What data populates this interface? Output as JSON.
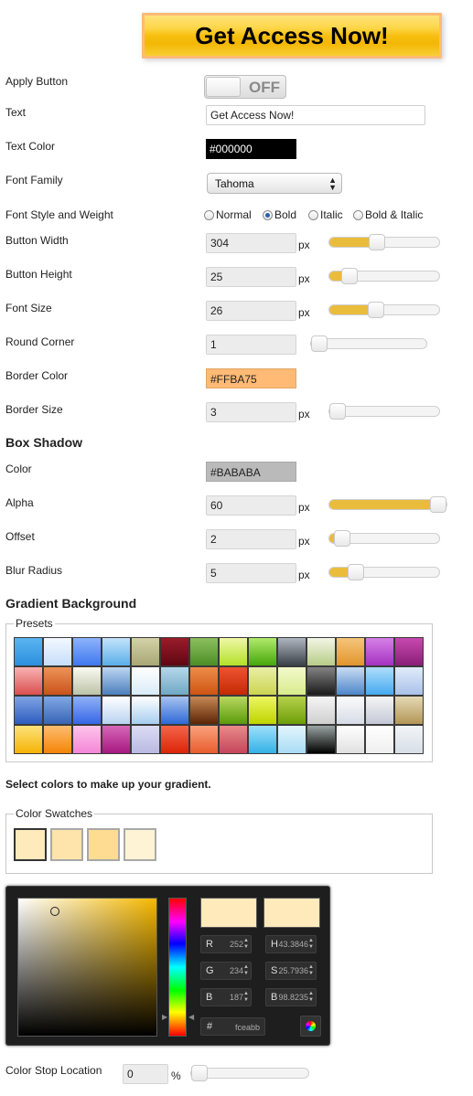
{
  "preview": {
    "text": "Get Access Now!"
  },
  "settings": {
    "apply": {
      "label": "Apply Button",
      "state": "OFF"
    },
    "text": {
      "label": "Text",
      "value": "Get Access Now!"
    },
    "text_color": {
      "label": "Text Color",
      "value": "#000000"
    },
    "font_family": {
      "label": "Font Family",
      "value": "Tahoma"
    },
    "font_style": {
      "label": "Font Style and Weight",
      "options": [
        "Normal",
        "Bold",
        "Italic",
        "Bold & Italic"
      ],
      "selected": "Bold"
    },
    "button_width": {
      "label": "Button Width",
      "value": "304",
      "unit": "px",
      "slider_fraction": 0.42
    },
    "button_height": {
      "label": "Button Height",
      "value": "25",
      "unit": "px",
      "slider_fraction": 0.13
    },
    "font_size": {
      "label": "Font Size",
      "value": "26",
      "unit": "px",
      "slider_fraction": 0.41
    },
    "round_corner": {
      "label": "Round Corner",
      "value": "1",
      "slider_fraction": 0.0
    },
    "border_color": {
      "label": "Border Color",
      "value": "#FFBA75"
    },
    "border_size": {
      "label": "Border Size",
      "value": "3",
      "unit": "px",
      "slider_fraction": 0.0
    }
  },
  "box_shadow": {
    "title": "Box Shadow",
    "color": {
      "label": "Color",
      "value": "#BABABA"
    },
    "alpha": {
      "label": "Alpha",
      "value": "60",
      "unit": "px",
      "slider_fraction": 1.0
    },
    "offset": {
      "label": "Offset",
      "value": "2",
      "unit": "px",
      "slider_fraction": 0.05
    },
    "blur": {
      "label": "Blur Radius",
      "value": "5",
      "unit": "px",
      "slider_fraction": 0.2
    }
  },
  "gradient": {
    "title": "Gradient Background",
    "presets_legend": "Presets",
    "instruction": "Select colors to make up your gradient.",
    "swatches_legend": "Color Swatches",
    "swatches": [
      "#feeabb",
      "#fee4ab",
      "#fedd92",
      "#fef3d4"
    ],
    "presets": [
      [
        "#5ab4ef",
        "#2c8fdf"
      ],
      [
        "#f2f8fe",
        "#c6defa"
      ],
      [
        "#8cb4fb",
        "#3f78ef"
      ],
      [
        "#c4e4fb",
        "#5aaee9"
      ],
      [
        "#d3d2a8",
        "#a9a775"
      ],
      [
        "#9a1c2a",
        "#5f0712"
      ],
      [
        "#8cc05f",
        "#4d8e26"
      ],
      [
        "#eff8a6",
        "#b4e02a"
      ],
      [
        "#b0ea6a",
        "#47a70a"
      ],
      [
        "#b0b6bf",
        "#3b4148"
      ],
      [
        "#f2f6e5",
        "#b8cc88"
      ],
      [
        "#f5c57a",
        "#e2952e"
      ],
      [
        "#d581e6",
        "#a632c1"
      ],
      [
        "#c749b0",
        "#8a1f77"
      ],
      [
        "#f7b2b2",
        "#db4f4f"
      ],
      [
        "#ee9358",
        "#c9521a"
      ],
      [
        "#fafaf2",
        "#bcc3a7"
      ],
      [
        "#bcd6f3",
        "#4c7fbd"
      ],
      [
        "#ffffff",
        "#d9ebf7"
      ],
      [
        "#b6d8ea",
        "#6fa7c4"
      ],
      [
        "#ec8d4b",
        "#cf5411"
      ],
      [
        "#ee5232",
        "#c22b02"
      ],
      [
        "#e8eea6",
        "#ccd552"
      ],
      [
        "#f3f9cc",
        "#d7ec8c"
      ],
      [
        "#828282",
        "#1b1b1b"
      ],
      [
        "#c8dcf3",
        "#4e86c9"
      ],
      [
        "#aeddfa",
        "#45aaf0"
      ],
      [
        "#e1ecfb",
        "#a9c1e9"
      ],
      [
        "#7fa4e4",
        "#2d5cbf"
      ],
      [
        "#80a8e6",
        "#3864b5"
      ],
      [
        "#8fb1f7",
        "#3566e6"
      ],
      [
        "#ffffff",
        "#b9d3f0"
      ],
      [
        "#ffffff",
        "#a6cdf0"
      ],
      [
        "#a8c2f0",
        "#2e69d6"
      ],
      [
        "#c78854",
        "#5c2505"
      ],
      [
        "#b8d85f",
        "#5a9a0b"
      ],
      [
        "#edf660",
        "#bfd400"
      ],
      [
        "#b6d24b",
        "#6d9e08"
      ],
      [
        "#f5f5f5",
        "#cfcfcf"
      ],
      [
        "#fbfbfb",
        "#d6dde6"
      ],
      [
        "#f5f5f5",
        "#c5c8d6"
      ],
      [
        "#e5d9b4",
        "#b39657"
      ],
      [
        "#fde27a",
        "#f5b305"
      ],
      [
        "#fdbd6f",
        "#f58406"
      ],
      [
        "#fdc4ea",
        "#f486d8"
      ],
      [
        "#d767b8",
        "#a5187f"
      ],
      [
        "#dcdcf4",
        "#b9b9e3"
      ],
      [
        "#f4654b",
        "#dc2407"
      ],
      [
        "#f9a27d",
        "#e95c2d"
      ],
      [
        "#e88a8a",
        "#c5455a"
      ],
      [
        "#9fdff9",
        "#33b2e6"
      ],
      [
        "#e3f5fd",
        "#a8dcf5"
      ],
      [
        "#9aa4a2",
        "#000000"
      ],
      [
        "#ffffff",
        "#e0e0e0"
      ],
      [
        "#ffffff",
        "#efefef"
      ],
      [
        "#f2f5f8",
        "#d7dee6"
      ]
    ]
  },
  "picker": {
    "new_color": "#feeabb",
    "old_color": "#feeabb",
    "fields": [
      {
        "key": "R",
        "value": "252"
      },
      {
        "key": "H",
        "value": "43.3846"
      },
      {
        "key": "G",
        "value": "234"
      },
      {
        "key": "S",
        "value": "25.7936"
      },
      {
        "key": "B",
        "value": "187"
      },
      {
        "key": "B",
        "value": "98.8235"
      }
    ],
    "hex_key": "#",
    "hex": "fceabb"
  },
  "color_stop": {
    "label": "Color Stop Location",
    "value": "0",
    "unit": "%",
    "slider_fraction": 0.0
  }
}
